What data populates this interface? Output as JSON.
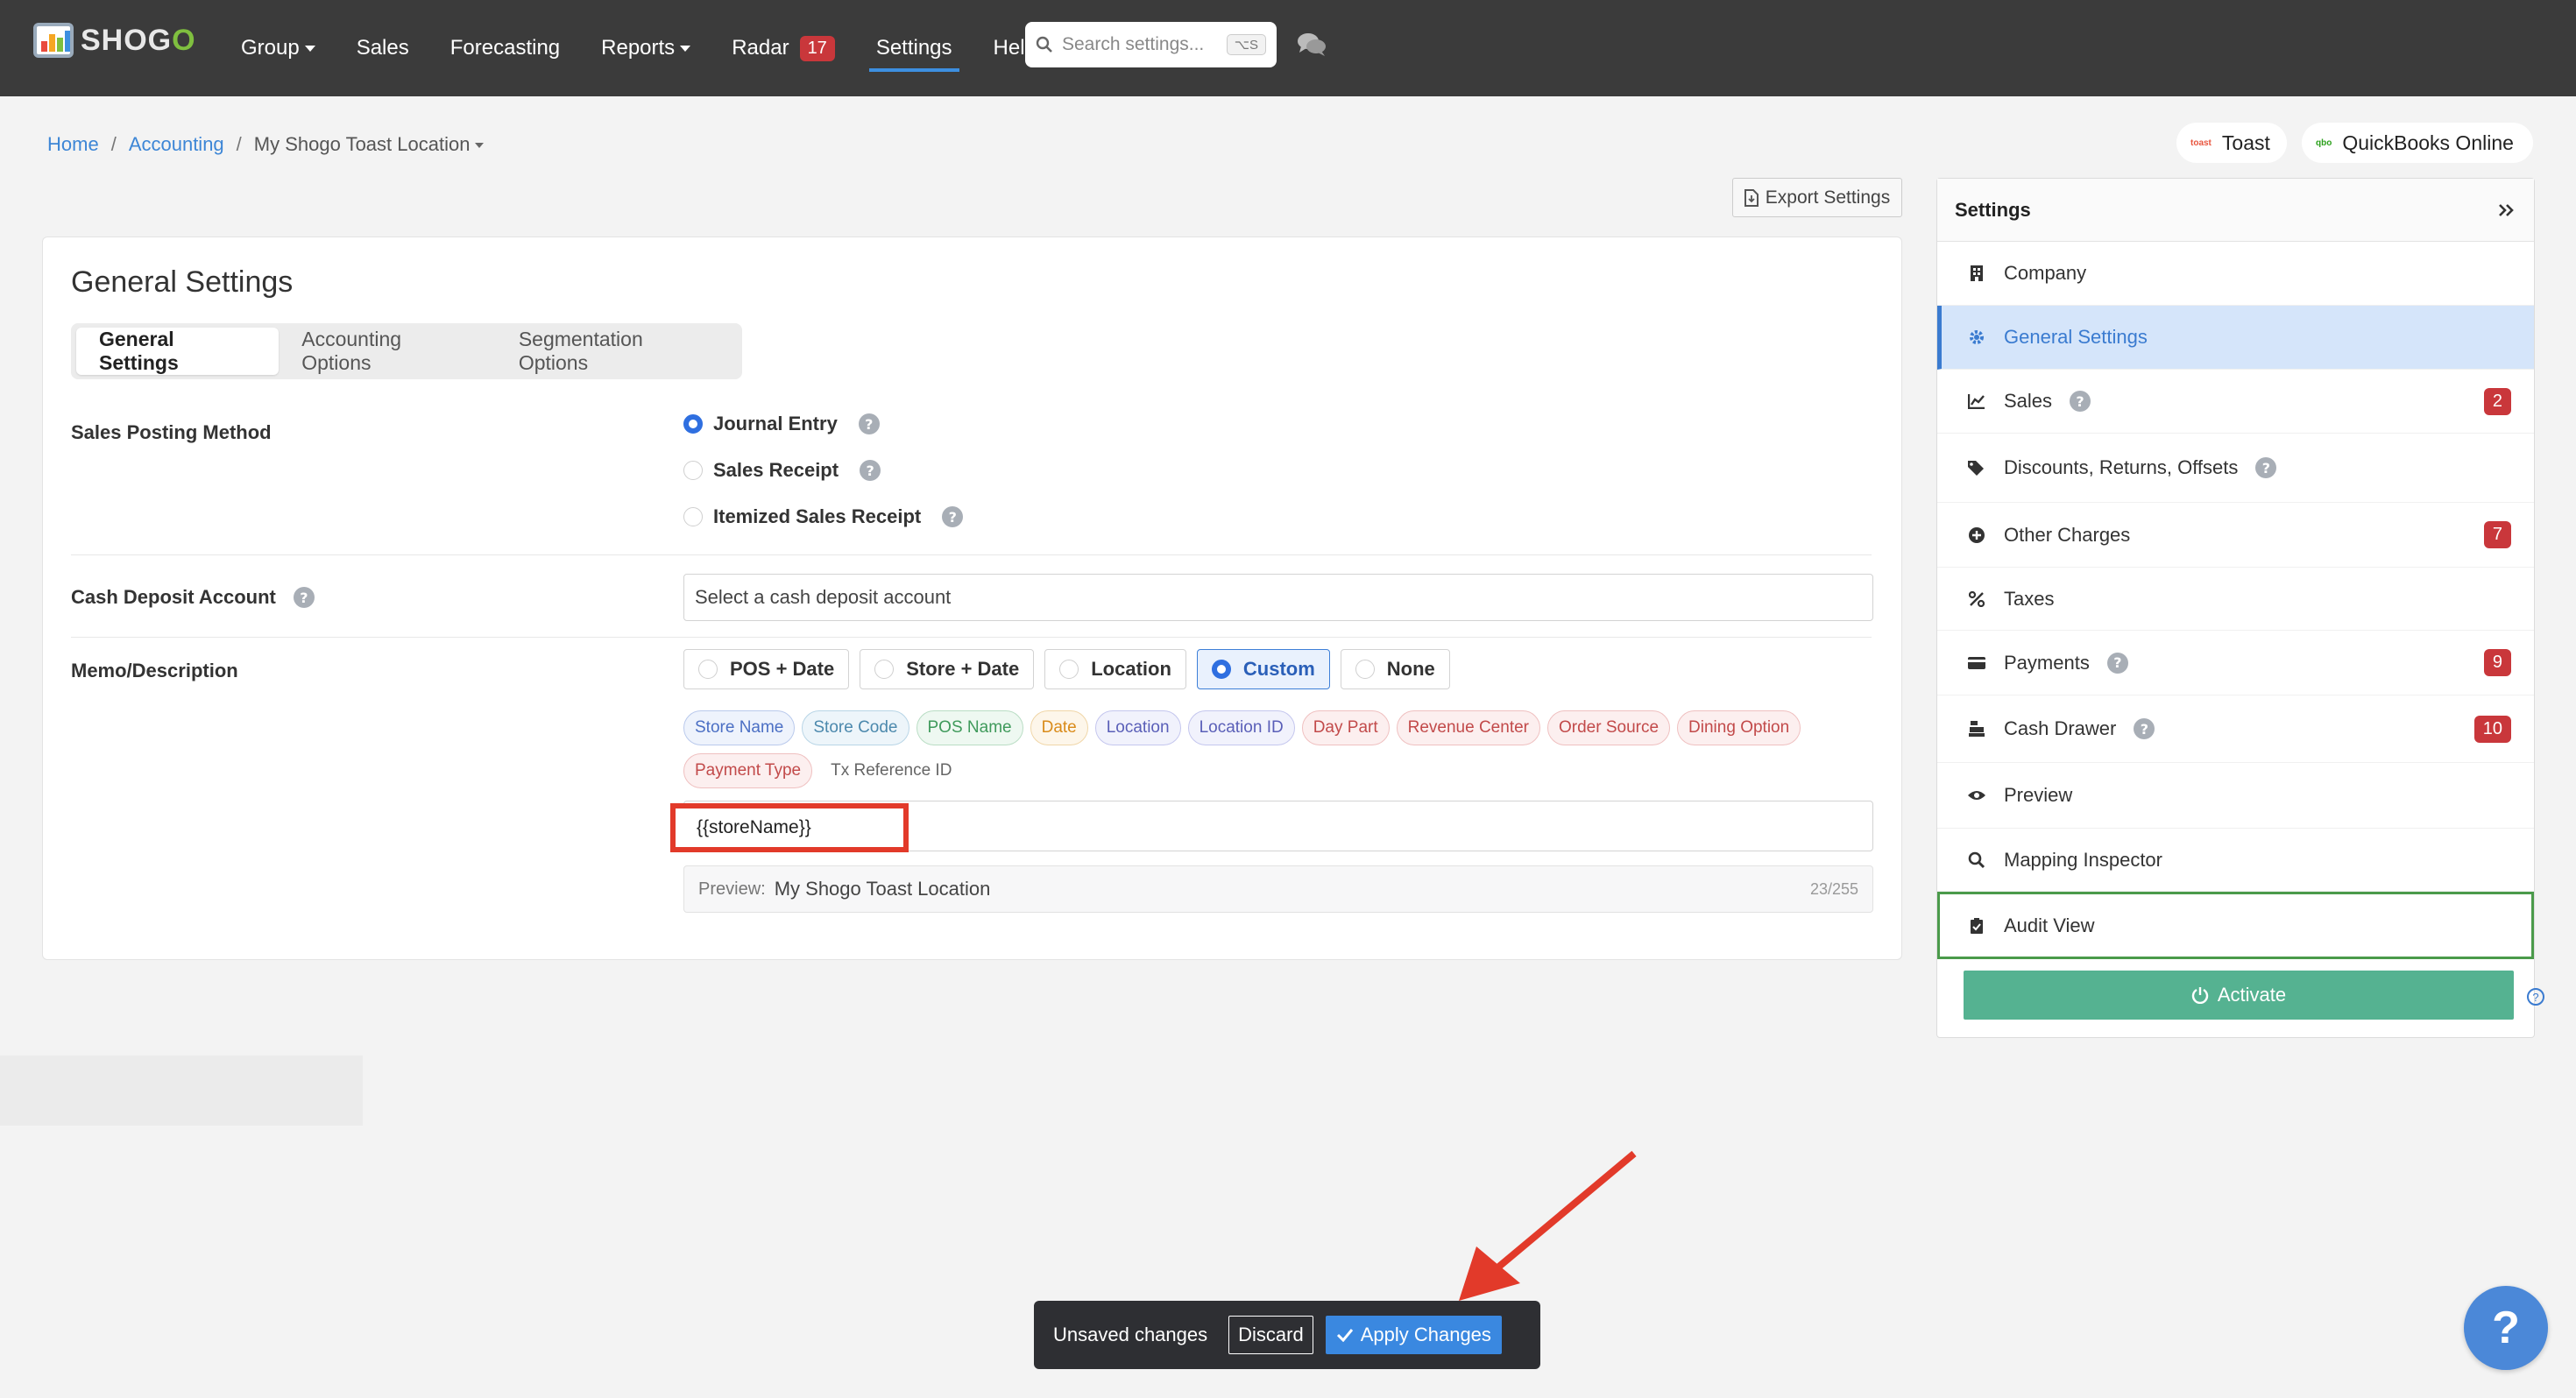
{
  "nav": {
    "logo_prefix": "SHOG",
    "logo_suffix": "O",
    "items": [
      {
        "label": "Group",
        "caret": true
      },
      {
        "label": "Sales"
      },
      {
        "label": "Forecasting"
      },
      {
        "label": "Reports",
        "caret": true
      },
      {
        "label": "Radar",
        "badge": "17"
      },
      {
        "label": "Settings",
        "active": true
      },
      {
        "label": "Help"
      }
    ],
    "search_placeholder": "Search settings...",
    "search_shortcut": "⌥S"
  },
  "breadcrumb": {
    "home": "Home",
    "sep": "/",
    "accounting": "Accounting",
    "current": "My Shogo Toast Location"
  },
  "integrations": {
    "pos": "Toast",
    "pos_logo_text": "toast",
    "accounting": "QuickBooks Online",
    "accounting_logo_text": "qbo"
  },
  "export_label": "Export Settings",
  "card": {
    "title": "General Settings",
    "tabs": [
      "General Settings",
      "Accounting Options",
      "Segmentation Options"
    ],
    "sales_posting": {
      "label": "Sales Posting Method",
      "options": [
        "Journal Entry",
        "Sales Receipt",
        "Itemized Sales Receipt"
      ]
    },
    "cash_deposit": {
      "label": "Cash Deposit Account",
      "placeholder": "Select a cash deposit account"
    },
    "memo": {
      "label": "Memo/Description",
      "options": [
        "POS + Date",
        "Store + Date",
        "Location",
        "Custom",
        "None"
      ],
      "chips_row1": [
        "Store Name",
        "Store Code",
        "POS Name",
        "Date",
        "Location",
        "Location ID",
        "Day Part",
        "Revenue Center",
        "Order Source",
        "Dining Option"
      ],
      "chips_row2": [
        "Payment Type",
        "Tx Reference ID"
      ],
      "template_value": "{{storeName}}",
      "preview_label": "Preview:",
      "preview_value": "My Shogo Toast Location",
      "char_count": "23/255"
    }
  },
  "sidebar": {
    "title": "Settings",
    "items": [
      {
        "label": "Company"
      },
      {
        "label": "General Settings",
        "active": true
      },
      {
        "label": "Sales",
        "help": true,
        "badge": "2"
      },
      {
        "label": "Discounts, Returns, Offsets",
        "help": true
      },
      {
        "label": "Other Charges",
        "badge": "7"
      },
      {
        "label": "Taxes"
      },
      {
        "label": "Payments",
        "help": true,
        "badge": "9"
      },
      {
        "label": "Cash Drawer",
        "help": true,
        "badge": "10"
      },
      {
        "label": "Preview"
      },
      {
        "label": "Mapping Inspector"
      },
      {
        "label": "Audit View"
      }
    ],
    "activate_label": "Activate"
  },
  "unsaved": {
    "message": "Unsaved changes",
    "discard": "Discard",
    "apply": "Apply Changes"
  },
  "help_fab": "?",
  "colors": {
    "navbar": "#3b3b3b",
    "accent_blue": "#3a7bd0",
    "badge_red": "#c9373b",
    "activate_green": "#55b291",
    "annotation_red": "#e23a2a"
  }
}
